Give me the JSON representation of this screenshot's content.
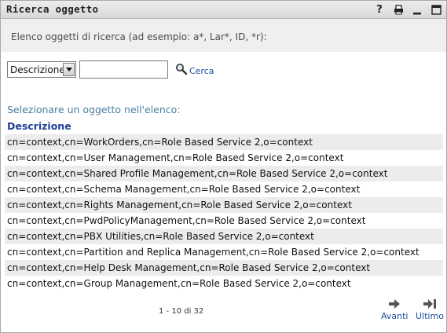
{
  "window": {
    "title": "Ricerca oggetto",
    "icons": [
      "help-icon",
      "print-icon",
      "minimize-icon",
      "maximize-icon"
    ],
    "help_glyph": "?"
  },
  "instructions": "Elenco oggetti di ricerca (ad esempio: a*, Lar*, ID, *r):",
  "search": {
    "field_selected": "Descrizione",
    "text_value": "",
    "button_label": "Cerca"
  },
  "list": {
    "prompt": "Selezionare un oggetto nell'elenco:",
    "column_header": "Descrizione",
    "rows": [
      "cn=context,cn=WorkOrders,cn=Role Based Service 2,o=context",
      "cn=context,cn=User Management,cn=Role Based Service 2,o=context",
      "cn=context,cn=Shared Profile Management,cn=Role Based Service 2,o=context",
      "cn=context,cn=Schema Management,cn=Role Based Service 2,o=context",
      "cn=context,cn=Rights Management,cn=Role Based Service 2,o=context",
      "cn=context,cn=PwdPolicyManagement,cn=Role Based Service 2,o=context",
      "cn=context,cn=PBX Utilities,cn=Role Based Service 2,o=context",
      "cn=context,cn=Partition and Replica Management,cn=Role Based Service 2,o=context",
      "cn=context,cn=Help Desk Management,cn=Role Based Service 2,o=context",
      "cn=context,cn=Group Management,cn=Role Based Service 2,o=context"
    ]
  },
  "pagination": {
    "range": "1 - 10 di 32",
    "next_label": "Avanti",
    "last_label": "Ultimo"
  },
  "colors": {
    "link": "#1f4fa0",
    "header_text": "#1f3f9a",
    "prompt_text": "#4a7ea0",
    "alt_row": "#ececec"
  }
}
